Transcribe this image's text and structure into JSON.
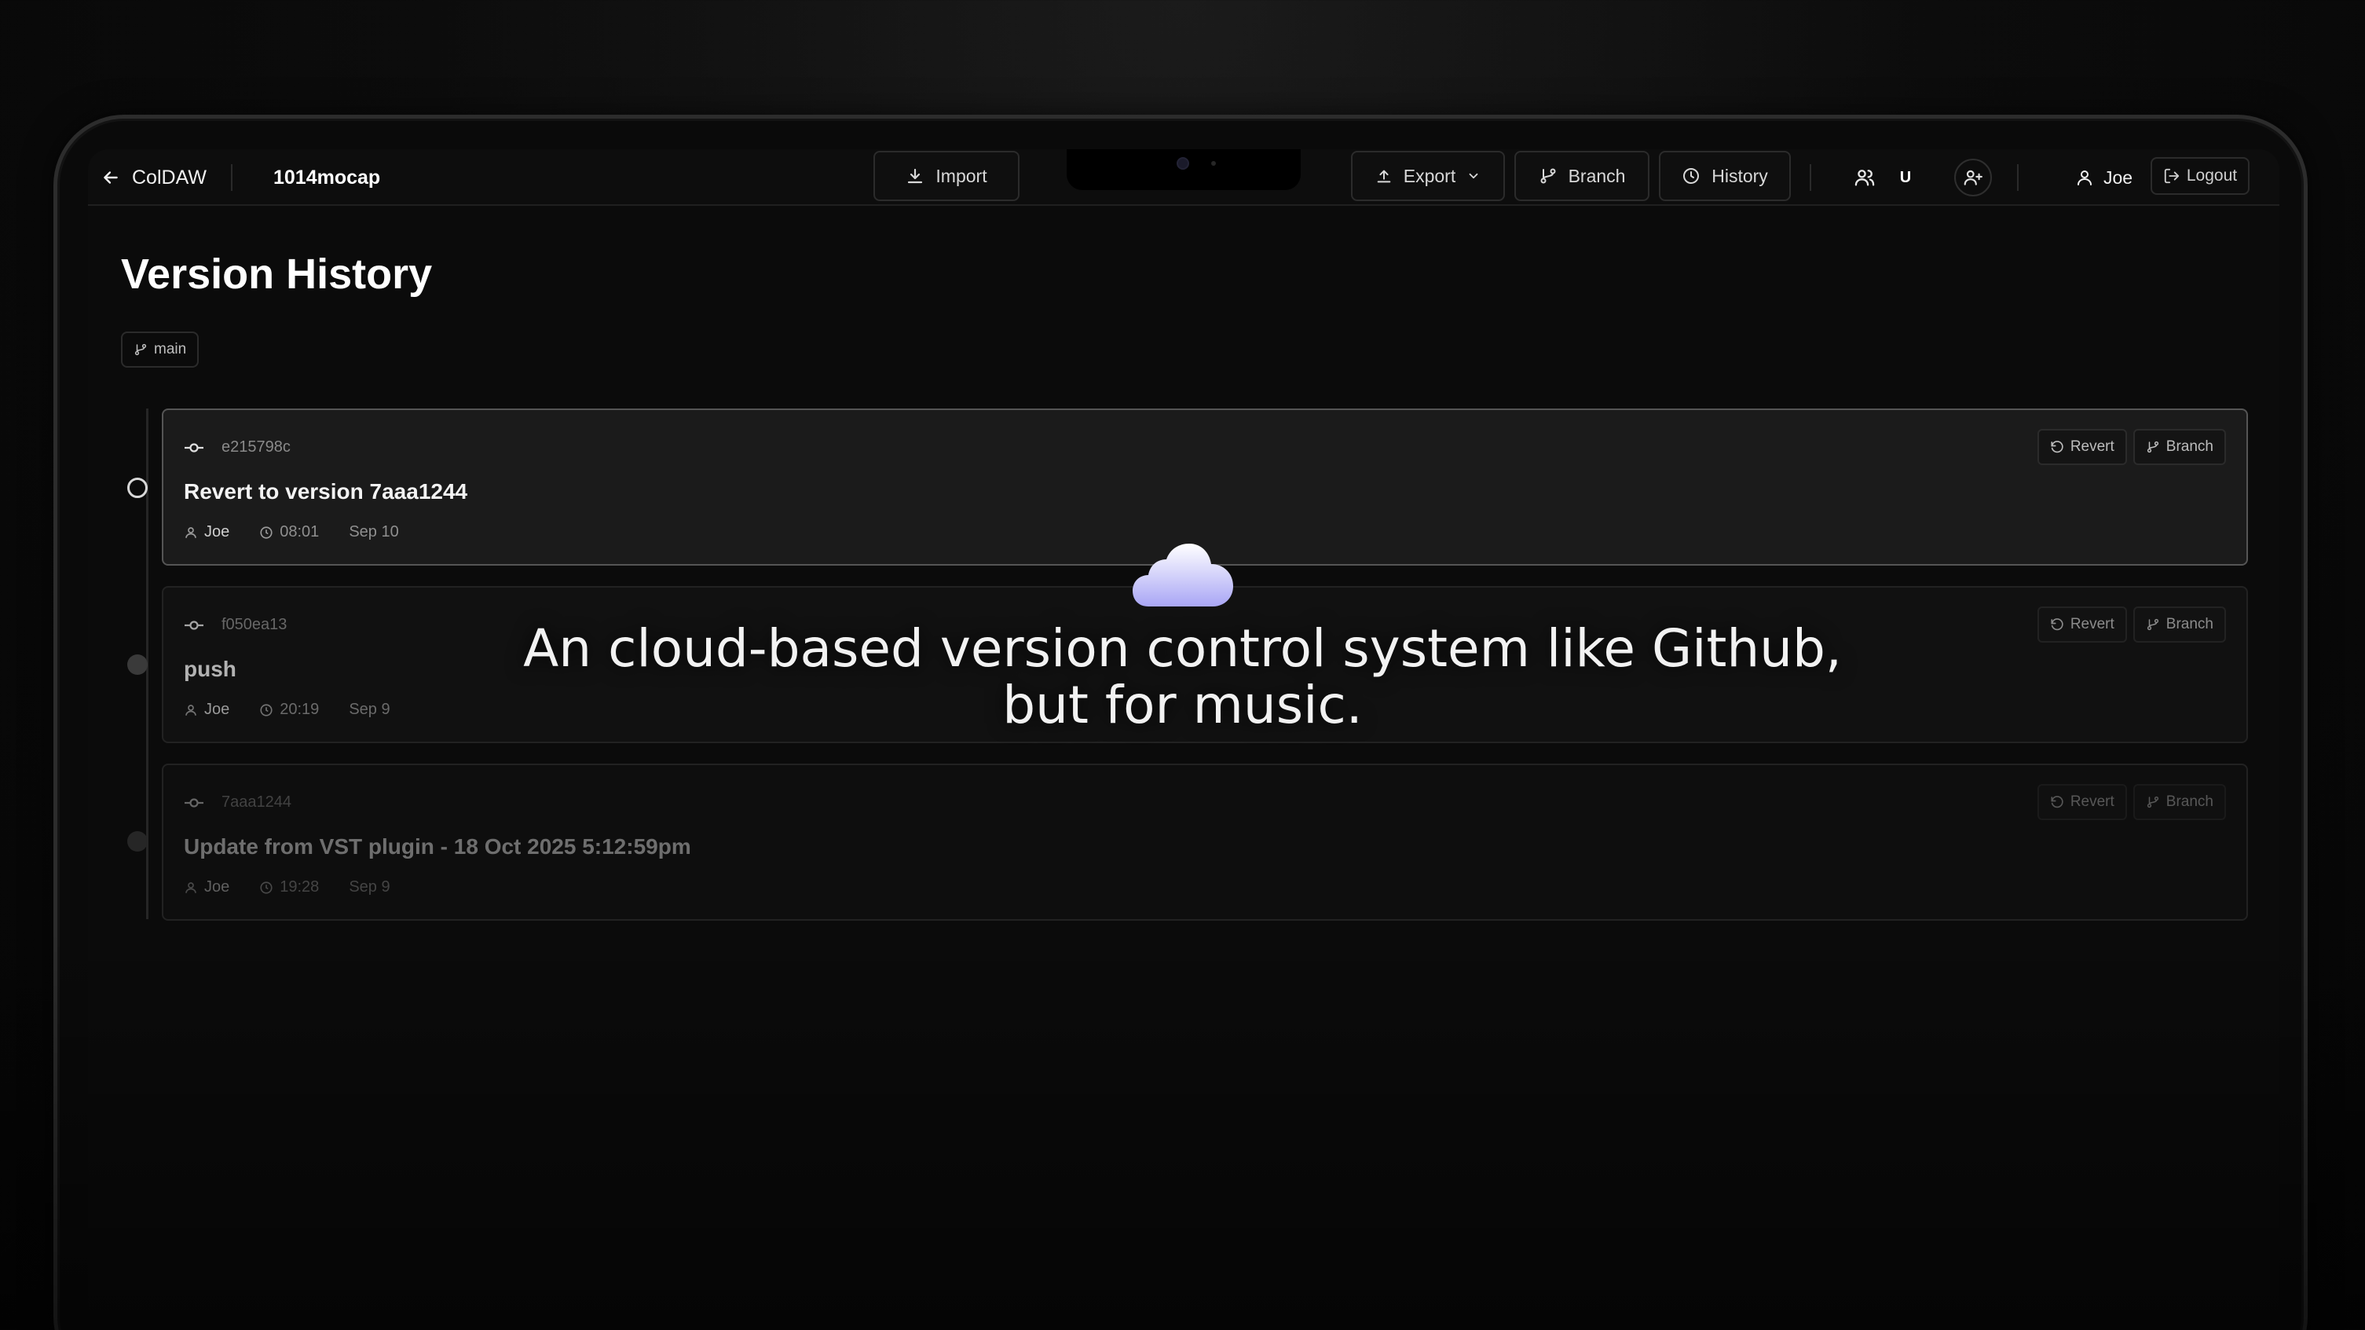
{
  "app": {
    "name": "ColDAW",
    "project": "1014mocap"
  },
  "toolbar": {
    "import_label": "Import",
    "export_label": "Export",
    "branch_label": "Branch",
    "history_label": "History",
    "user_initial": "U",
    "user_name": "Joe",
    "logout_label": "Logout"
  },
  "page": {
    "title": "Version History",
    "branch": "main"
  },
  "commits": [
    {
      "hash": "e215798c",
      "message": "Revert to version 7aaa1244",
      "author": "Joe",
      "time": "08:01",
      "date": "Sep 10",
      "revert_label": "Revert",
      "branch_label": "Branch"
    },
    {
      "hash": "f050ea13",
      "message": "push",
      "author": "Joe",
      "time": "20:19",
      "date": "Sep 9",
      "revert_label": "Revert",
      "branch_label": "Branch"
    },
    {
      "hash": "7aaa1244",
      "message": "Update from VST plugin - 18 Oct 2025 5:12:59pm",
      "author": "Joe",
      "time": "19:28",
      "date": "Sep 9",
      "revert_label": "Revert",
      "branch_label": "Branch"
    }
  ],
  "overlay": {
    "tagline_line1": "An cloud-based version control system like Github,",
    "tagline_line2": "but for music."
  },
  "colors": {
    "background": "#0b0b0b",
    "cloud_top": "#ffffff",
    "cloud_bottom": "#a9a6f5"
  }
}
